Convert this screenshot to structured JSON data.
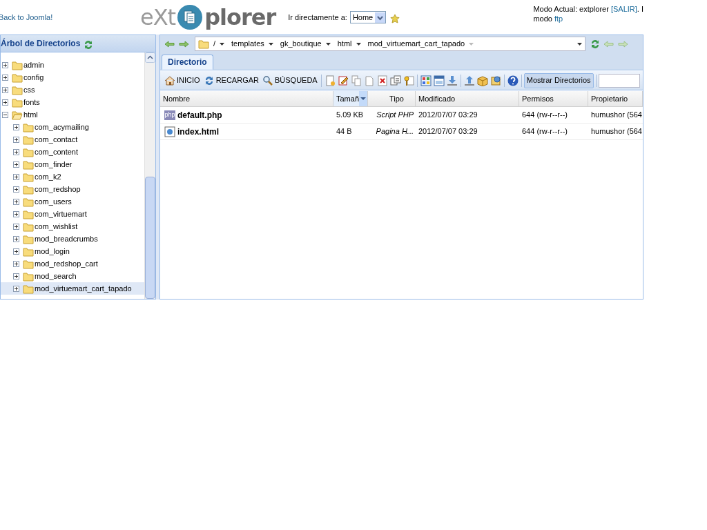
{
  "header": {
    "back_link": "Back to Joomla!",
    "logo": {
      "left": "eXt",
      "right": "plorer"
    },
    "goto": {
      "label": "Ir directamente a:",
      "value": "Home"
    },
    "mode": {
      "line1_before": "Modo Actual: extplorer ",
      "logout_link": "[SALIR]",
      "line1_after": ". I",
      "line2_before": "modo ",
      "mode_link": "ftp"
    }
  },
  "tree": {
    "title": "Árbol de Directorios",
    "items": [
      {
        "label": "admin",
        "expanded": false,
        "selected": false
      },
      {
        "label": "config",
        "expanded": false,
        "selected": false
      },
      {
        "label": "css",
        "expanded": false,
        "selected": false
      },
      {
        "label": "fonts",
        "expanded": false,
        "selected": false
      },
      {
        "label": "html",
        "expanded": true,
        "selected": false,
        "children": [
          {
            "label": "com_acymailing",
            "expanded": false,
            "selected": false
          },
          {
            "label": "com_contact",
            "expanded": false,
            "selected": false
          },
          {
            "label": "com_content",
            "expanded": false,
            "selected": false
          },
          {
            "label": "com_finder",
            "expanded": false,
            "selected": false
          },
          {
            "label": "com_k2",
            "expanded": false,
            "selected": false
          },
          {
            "label": "com_redshop",
            "expanded": false,
            "selected": false
          },
          {
            "label": "com_users",
            "expanded": false,
            "selected": false
          },
          {
            "label": "com_virtuemart",
            "expanded": false,
            "selected": false
          },
          {
            "label": "com_wishlist",
            "expanded": false,
            "selected": false
          },
          {
            "label": "mod_breadcrumbs",
            "expanded": false,
            "selected": false
          },
          {
            "label": "mod_login",
            "expanded": false,
            "selected": false
          },
          {
            "label": "mod_redshop_cart",
            "expanded": false,
            "selected": false
          },
          {
            "label": "mod_search",
            "expanded": false,
            "selected": false
          },
          {
            "label": "mod_virtuemart_cart_tapado",
            "expanded": false,
            "selected": true
          }
        ]
      }
    ]
  },
  "breadcrumb": [
    "/",
    "templates",
    "gk_boutique",
    "html",
    "mod_virtuemart_cart_tapado"
  ],
  "tabs": [
    {
      "label": "Directorio",
      "selected": true
    }
  ],
  "toolbar": {
    "buttons": [
      {
        "label": "INICIO",
        "kind": "home"
      },
      {
        "label": "RECARGAR",
        "kind": "reload"
      },
      {
        "label": "BÚSQUEDA",
        "kind": "search"
      }
    ],
    "toggle": {
      "label": "Mostrar Directorios",
      "selected": true
    }
  },
  "table": {
    "columns": [
      {
        "label": "Nombre",
        "sorted": false
      },
      {
        "label": "Tamañ",
        "sorted": true
      },
      {
        "label": "Tipo",
        "sorted": false
      },
      {
        "label": "Modificado",
        "sorted": false
      },
      {
        "label": "Permisos",
        "sorted": false
      },
      {
        "label": "Propietario",
        "sorted": false
      }
    ],
    "rows": [
      {
        "kind": "php",
        "icon_text": "php",
        "name": "default.php",
        "size": "5.09 KB",
        "type": "Script PHP",
        "modified": "2012/07/07 03:29",
        "perms": "644 (rw-r--r--)",
        "owner": "humushor (564"
      },
      {
        "kind": "html",
        "name": "index.html",
        "size": "44 B",
        "type": "Pagina H...",
        "modified": "2012/07/07 03:29",
        "perms": "644 (rw-r--r--)",
        "owner": "humushor (564"
      }
    ]
  }
}
